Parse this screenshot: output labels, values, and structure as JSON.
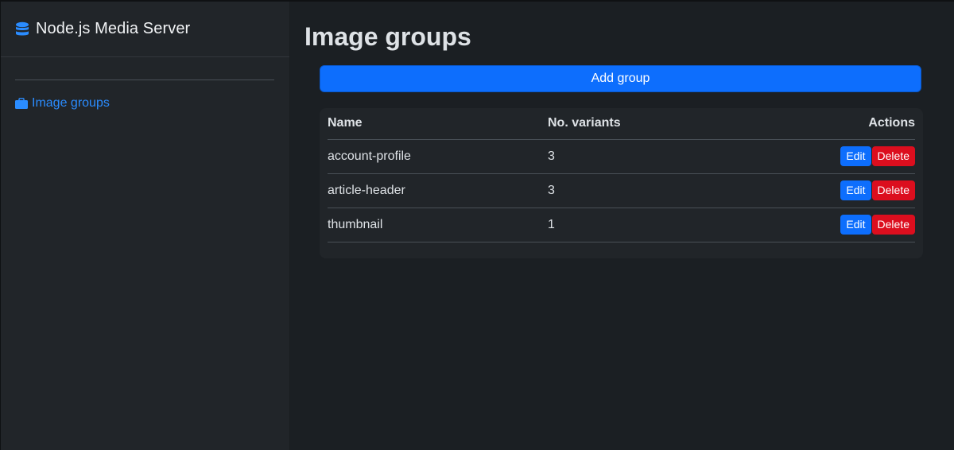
{
  "sidebar": {
    "brand": "Node.js Media Server",
    "brand_icon": "database-icon",
    "nav": [
      {
        "label": "Image groups",
        "icon": "briefcase-icon",
        "color": "#2a8cff"
      }
    ]
  },
  "main": {
    "title": "Image groups",
    "add_button": "Add group",
    "table": {
      "headers": {
        "name": "Name",
        "variants": "No. variants",
        "actions": "Actions"
      },
      "rows": [
        {
          "name": "account-profile",
          "variants": "3"
        },
        {
          "name": "article-header",
          "variants": "3"
        },
        {
          "name": "thumbnail",
          "variants": "1"
        }
      ],
      "edit_label": "Edit",
      "delete_label": "Delete"
    }
  },
  "colors": {
    "primary": "#0d6efd",
    "danger": "#dc0e1e",
    "link": "#2a8cff"
  }
}
